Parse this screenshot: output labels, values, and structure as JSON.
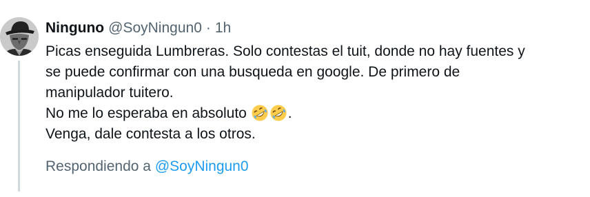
{
  "tweet": {
    "author_name": "Ninguno",
    "author_handle": "@SoyNingun0",
    "separator": "·",
    "timestamp": "1h",
    "lines": [
      "Picas enseguida Lumbreras. Solo contestas el tuit, donde no hay fuentes y",
      "se puede confirmar con una busqueda en google. De primero de",
      "manipulador tuitero.",
      "No me lo esperaba en absoluto",
      "Venga, dale contesta a los otros."
    ],
    "line4_suffix": ".",
    "emoji": "rolling-on-the-floor-laughing-emoji",
    "emoji_count": 2,
    "reply_label": "Respondiendo a",
    "reply_handle": "@SoyNingun0"
  },
  "colors": {
    "text_primary": "#0f1419",
    "text_secondary": "#536471",
    "link": "#1d9bf0",
    "thread_line": "#cfd9de",
    "emoji_face": "#ffcc4d"
  }
}
